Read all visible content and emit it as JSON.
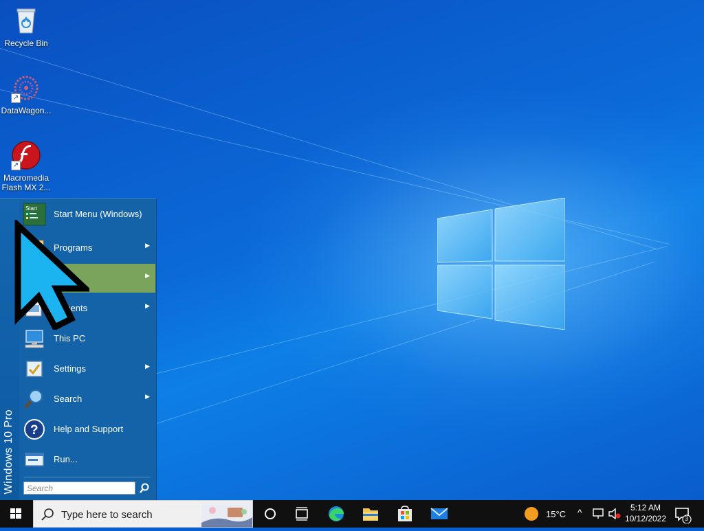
{
  "desktop": {
    "icons": [
      {
        "label": "Recycle Bin",
        "icon": "recycle-bin-icon"
      },
      {
        "label": "DataWagon...",
        "icon": "datawagon-icon"
      },
      {
        "label": "Macromedia Flash MX 2...",
        "icon": "flash-icon"
      }
    ]
  },
  "start_menu": {
    "side_label": "Windows 10 Pro",
    "header_icon_text": "Start",
    "items": [
      {
        "label": "Start Menu (Windows)",
        "icon": "start-menu-icon",
        "submenu": false
      },
      {
        "label": "Programs",
        "icon": "programs-icon",
        "submenu": true
      },
      {
        "label": "s",
        "icon": "favorites-icon",
        "submenu": true
      },
      {
        "label": "cuments",
        "icon": "documents-icon",
        "submenu": true
      },
      {
        "label": "This PC",
        "icon": "computer-icon",
        "submenu": false
      },
      {
        "label": "Settings",
        "icon": "settings-icon",
        "submenu": true
      },
      {
        "label": "Search",
        "icon": "search-icon",
        "submenu": true
      },
      {
        "label": "Help and Support",
        "icon": "help-icon",
        "submenu": false
      },
      {
        "label": "Run...",
        "icon": "run-icon",
        "submenu": false
      }
    ],
    "search_placeholder": "Search",
    "arrow_glyph": "▶"
  },
  "taskbar": {
    "search_placeholder": "Type here to search",
    "weather": "15°C",
    "clock_time": "5:12 AM",
    "clock_date": "10/12/2022",
    "notification_count": "3"
  },
  "colors": {
    "start_menu_bg": "#1462a8",
    "highlight": "#7aa35c",
    "taskbar": "#101010"
  }
}
